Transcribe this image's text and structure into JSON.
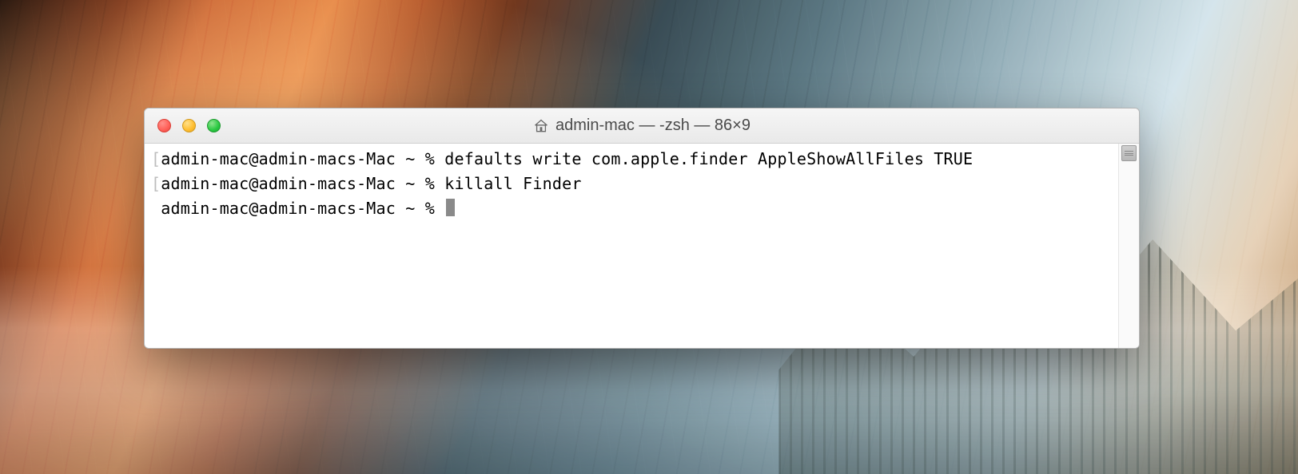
{
  "window": {
    "title_icon": "home-icon",
    "title": "admin-mac — -zsh — 86×9"
  },
  "terminal": {
    "lines": [
      {
        "bracket": true,
        "prompt": "admin-mac@admin-macs-Mac ~ %",
        "command": "defaults write com.apple.finder AppleShowAllFiles TRUE"
      },
      {
        "bracket": true,
        "prompt": "admin-mac@admin-macs-Mac ~ %",
        "command": "killall Finder"
      },
      {
        "bracket": false,
        "prompt": "admin-mac@admin-macs-Mac ~ %",
        "command": "",
        "cursor": true
      }
    ]
  },
  "traffic_lights": {
    "close": "close",
    "minimize": "minimize",
    "zoom": "zoom"
  }
}
